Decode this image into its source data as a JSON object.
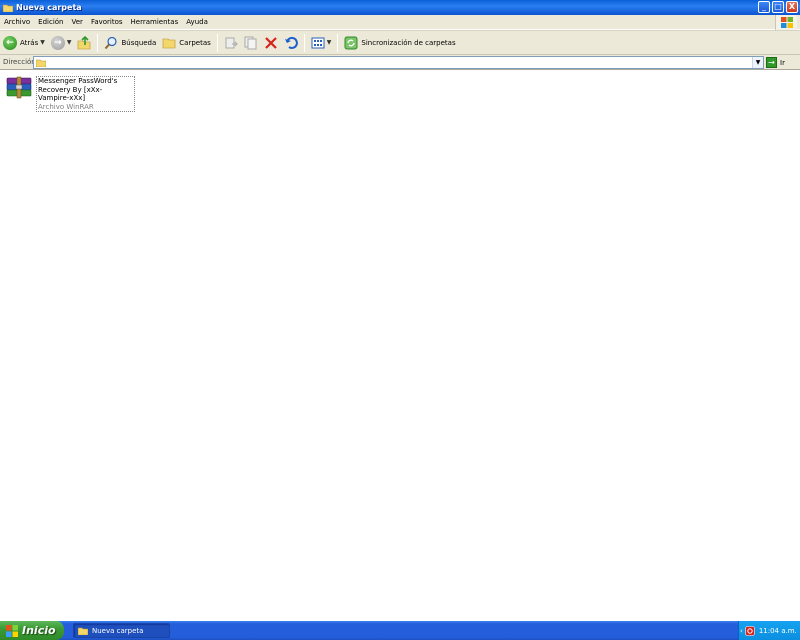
{
  "window": {
    "title": "Nueva carpeta",
    "controls": {
      "minimize": "_",
      "maximize": "□",
      "close": "X"
    }
  },
  "menu": [
    "Archivo",
    "Edición",
    "Ver",
    "Favoritos",
    "Herramientas",
    "Ayuda"
  ],
  "toolbar": {
    "back_label": "Atrás",
    "search_label": "Búsqueda",
    "folders_label": "Carpetas",
    "sync_label": "Sincronización de carpetas"
  },
  "address": {
    "label": "Dirección",
    "value": "",
    "go_label": "Ir"
  },
  "files": [
    {
      "name_line1": "Messenger PassWord's",
      "name_line2": "Recovery By [xXx-Vampire-xXx]",
      "type": "Archivo WinRAR",
      "icon": "winrar-archive-icon"
    }
  ],
  "taskbar": {
    "start_label": "Inicio",
    "task_label": "Nueva carpeta",
    "clock": "11:04 a.m."
  },
  "colors": {
    "titlebar": "#0a5fd8",
    "chrome": "#ece9d8",
    "taskbar": "#245edb",
    "start": "#3c9a35"
  }
}
